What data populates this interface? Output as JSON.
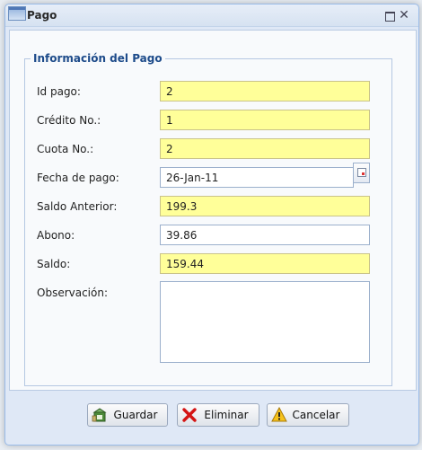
{
  "window": {
    "title": "Pago"
  },
  "fieldset": {
    "legend": "Información del Pago"
  },
  "form": {
    "id_pago": {
      "label": "Id pago:",
      "value": "2"
    },
    "credito_no": {
      "label": "Crédito No.:",
      "value": "1"
    },
    "cuota_no": {
      "label": "Cuota No.:",
      "value": "2"
    },
    "fecha_pago": {
      "label": "Fecha de pago:",
      "value": "26-Jan-11"
    },
    "saldo_anterior": {
      "label": "Saldo Anterior:",
      "value": "199.3"
    },
    "abono": {
      "label": "Abono:",
      "value": "39.86"
    },
    "saldo": {
      "label": "Saldo:",
      "value": "159.44"
    },
    "observacion": {
      "label": "Observación:",
      "value": ""
    }
  },
  "buttons": {
    "guardar": "Guardar",
    "eliminar": "Eliminar",
    "cancelar": "Cancelar"
  },
  "icons": {
    "window": "window-icon",
    "maximize": "maximize-icon",
    "close": "close-icon",
    "calendar": "calendar-icon",
    "save": "save-icon",
    "delete": "delete-x-icon",
    "cancel": "warning-icon"
  },
  "colors": {
    "readonly_field": "#ffff99",
    "legend": "#1d4b8a",
    "window_border": "#99bbe8"
  }
}
